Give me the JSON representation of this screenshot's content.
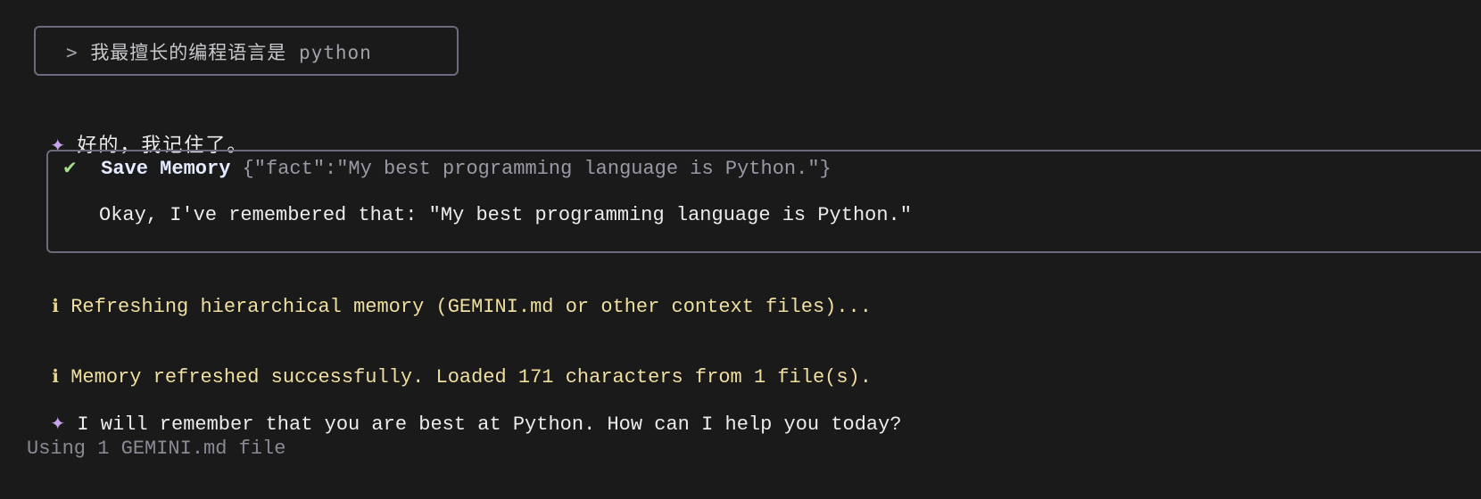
{
  "prompt": {
    "arrow": ">",
    "text_cn": "我最擅长的编程语言是",
    "text_latin": "python"
  },
  "reply1": {
    "icon": "sparkle-icon",
    "text": "好的，我记住了。"
  },
  "tool_call": {
    "status_icon": "check-icon",
    "name": "Save Memory",
    "args": "{\"fact\":\"My best programming language is Python.\"}",
    "result": "Okay, I've remembered that: \"My best programming language is Python.\""
  },
  "info1": {
    "icon": "ℹ",
    "text": "Refreshing hierarchical memory (GEMINI.md or other context files)..."
  },
  "info2": {
    "icon": "ℹ",
    "text": "Memory refreshed successfully. Loaded 171 characters from 1 file(s)."
  },
  "reply2": {
    "icon": "sparkle-icon",
    "text": "I will remember that you are best at Python. How can I help you today?"
  },
  "footer": {
    "text": "Using 1 GEMINI.md file"
  },
  "colors": {
    "background": "#1a1a1a",
    "border": "#6b6b7b",
    "sparkle": "#c9a4ef",
    "info": "#f0dfa0",
    "check": "#a6dd8e"
  }
}
